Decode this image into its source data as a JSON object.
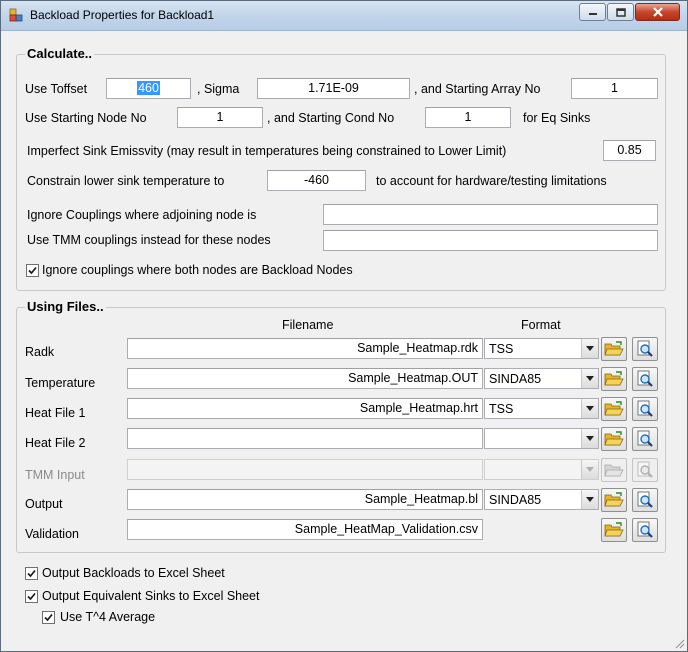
{
  "window": {
    "title": "Backload Properties for Backload1"
  },
  "calculate": {
    "title": "Calculate..",
    "use_toffset_label": "Use Toffset",
    "toffset_value": "460",
    "sigma_label": ", Sigma",
    "sigma_value": "1.71E-09",
    "starting_array_label": ", and Starting Array No",
    "starting_array_value": "1",
    "starting_node_label": "Use Starting Node No",
    "starting_node_value": "1",
    "starting_cond_label": ", and Starting Cond No",
    "starting_cond_value": "1",
    "eq_sinks_label": "for Eq Sinks",
    "emissivity_label": "Imperfect Sink Emissvity (may result in temperatures being constrained to Lower Limit)",
    "emissivity_value": "0.85",
    "constrain_label": "Constrain lower sink temperature to",
    "constrain_value": "-460",
    "constrain_suffix": "to account for hardware/testing limitations",
    "ignore_couplings_label": "Ignore Couplings where adjoining node is",
    "ignore_couplings_value": "",
    "tmm_couplings_label": "Use TMM couplings instead for these nodes",
    "tmm_couplings_value": "",
    "ignore_backload_label": "Ignore couplings where both nodes are Backload Nodes",
    "ignore_backload_checked": true
  },
  "files": {
    "title": "Using Files..",
    "filename_header": "Filename",
    "format_header": "Format",
    "rows": [
      {
        "label": "Radk",
        "filename": "Sample_Heatmap.rdk",
        "format": "TSS",
        "disabled": false,
        "has_format": true
      },
      {
        "label": "Temperature",
        "filename": "Sample_Heatmap.OUT",
        "format": "SINDA85",
        "disabled": false,
        "has_format": true
      },
      {
        "label": "Heat File 1",
        "filename": "Sample_Heatmap.hrt",
        "format": "TSS",
        "disabled": false,
        "has_format": true
      },
      {
        "label": "Heat File 2",
        "filename": "",
        "format": "",
        "disabled": false,
        "has_format": true
      },
      {
        "label": "TMM Input",
        "filename": "",
        "format": "",
        "disabled": true,
        "has_format": true
      },
      {
        "label": "Output",
        "filename": "Sample_Heatmap.bl",
        "format": "SINDA85",
        "disabled": false,
        "has_format": true
      },
      {
        "label": "Validation",
        "filename": "Sample_HeatMap_Validation.csv",
        "format": "",
        "disabled": false,
        "has_format": false
      }
    ]
  },
  "options": {
    "backloads_excel_label": "Output Backloads to Excel Sheet",
    "backloads_excel_checked": true,
    "eq_sinks_excel_label": "Output Equivalent Sinks to Excel Sheet",
    "eq_sinks_excel_checked": true,
    "t4_average_label": "Use T^4 Average",
    "t4_average_checked": true
  },
  "icons": {
    "folder": "open-folder-icon",
    "view": "magnifier-view-icon",
    "check": "checkmark-icon"
  },
  "colors": {
    "selection": "#3399ff",
    "titlebar": "#c2d5ea",
    "close": "#c5462d"
  }
}
